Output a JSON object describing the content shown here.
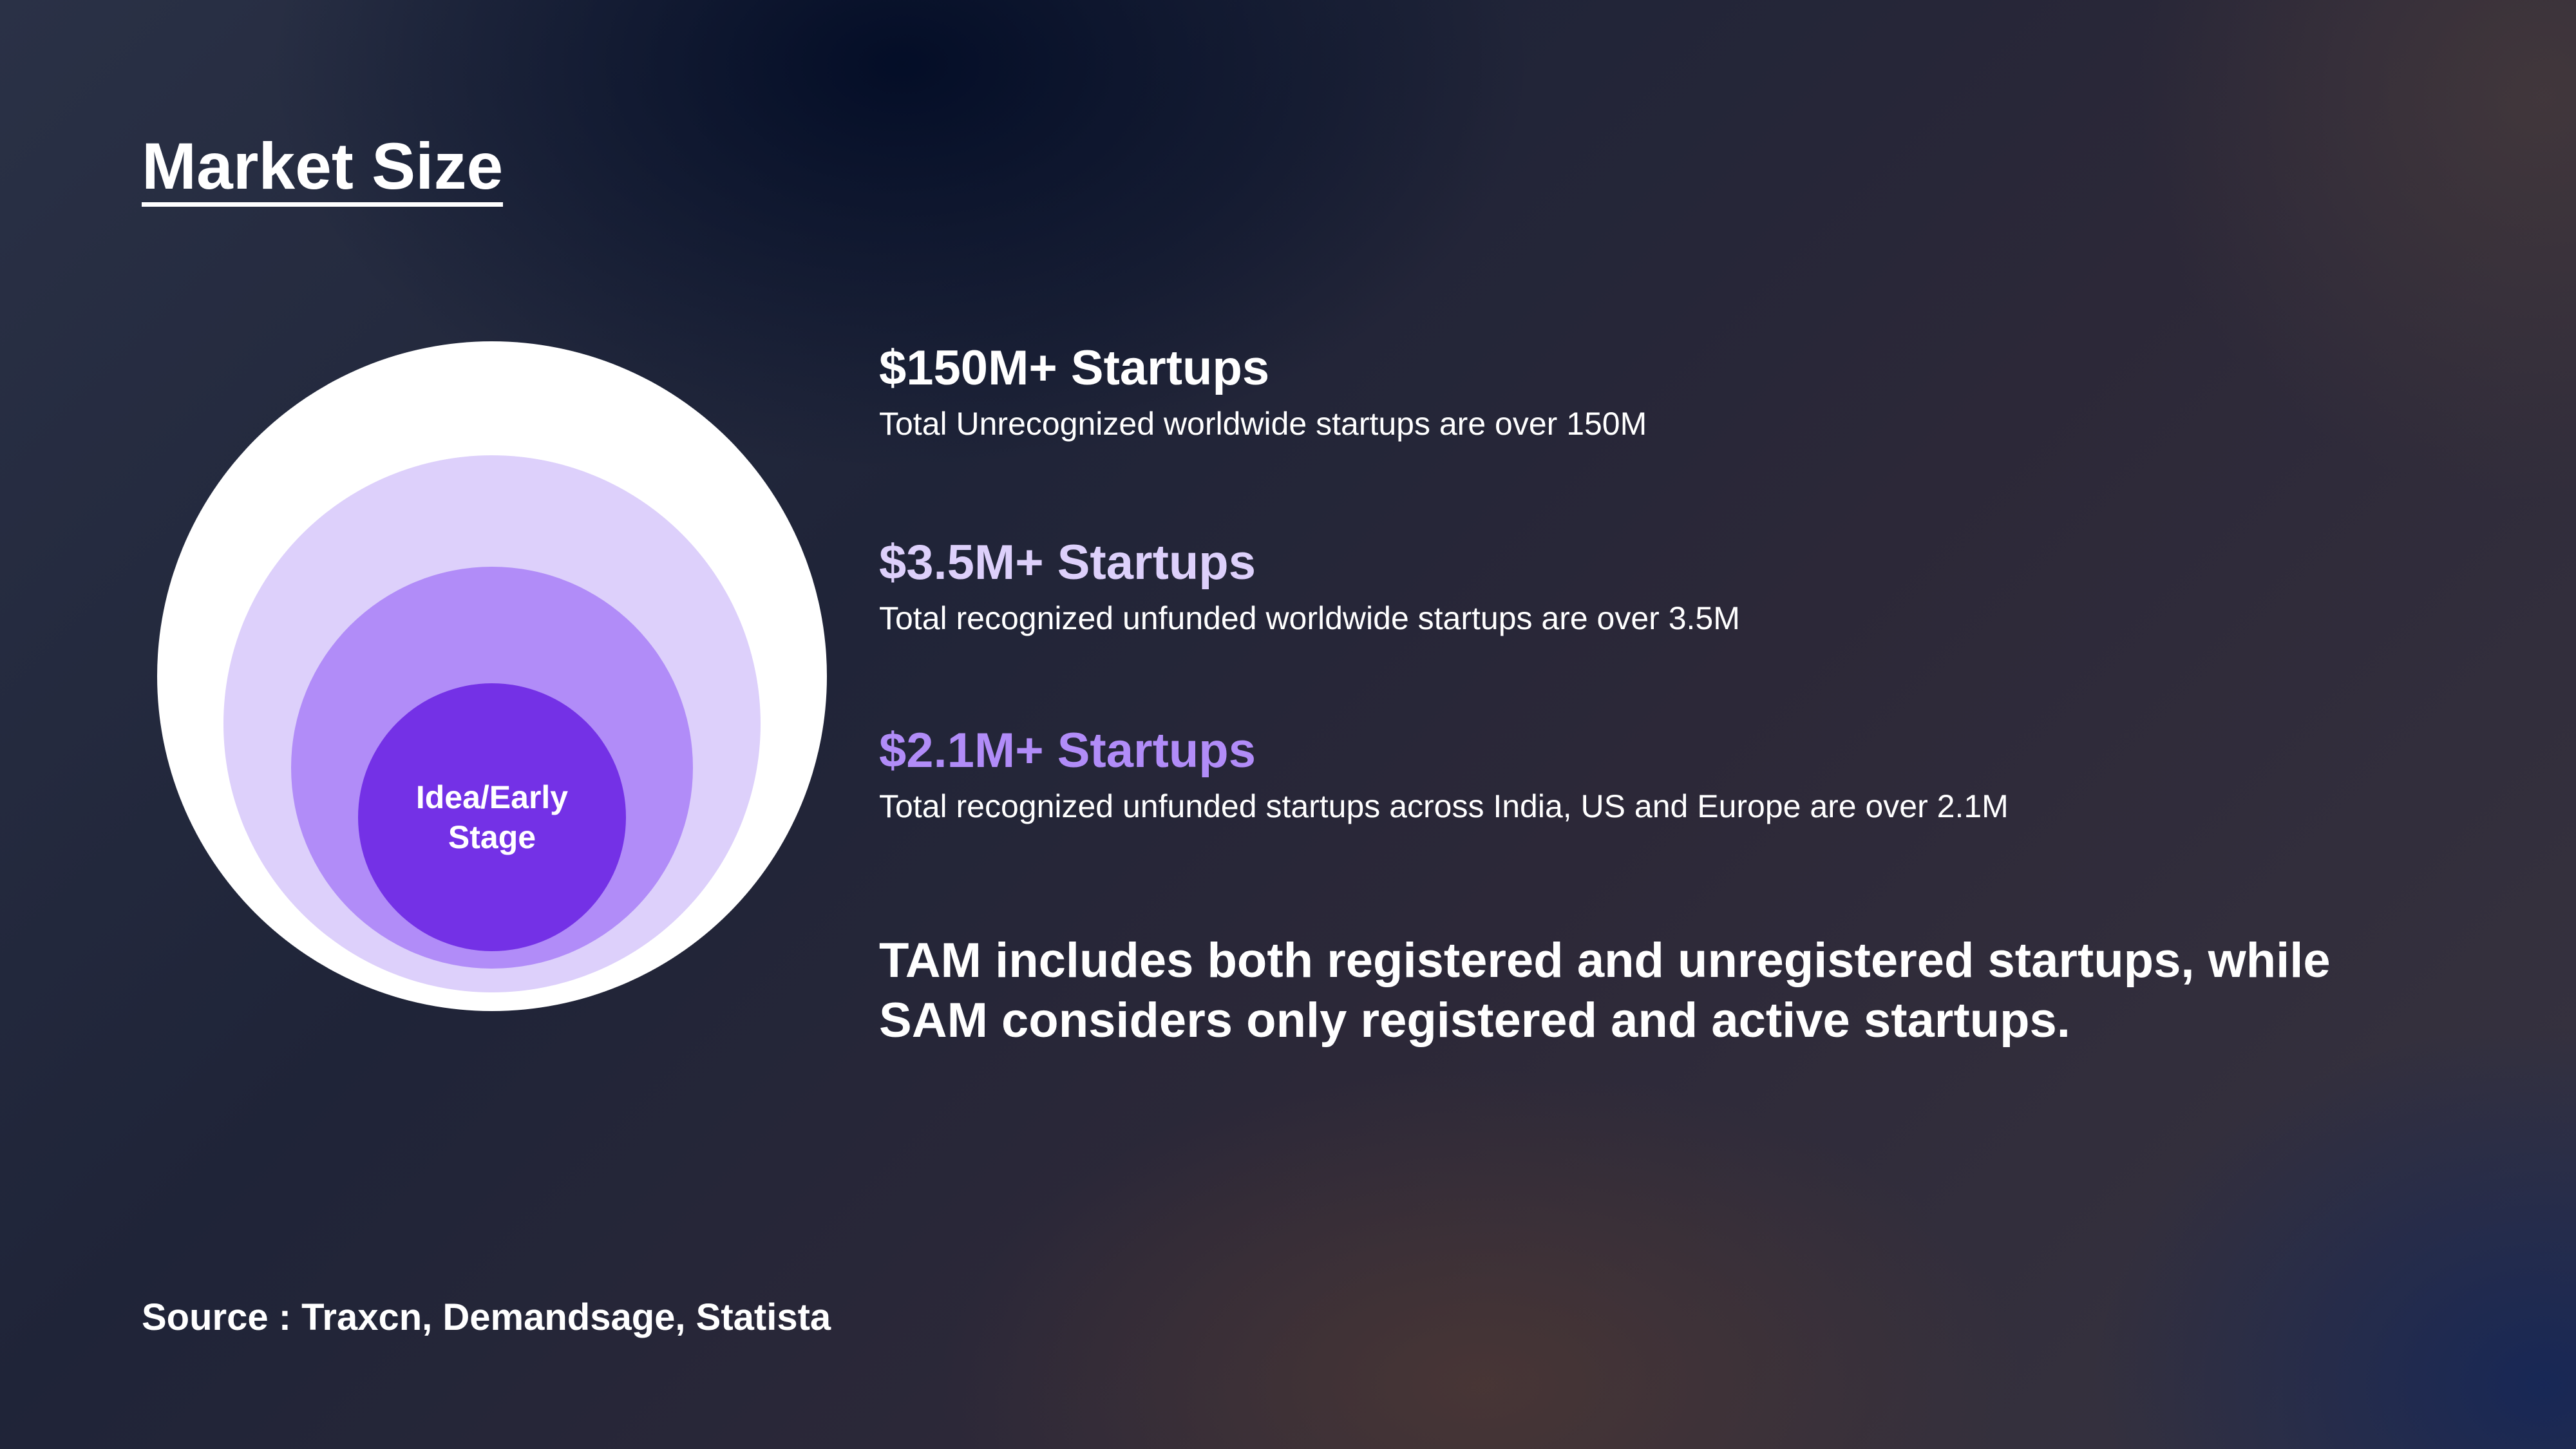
{
  "title": "Market Size",
  "diagram": {
    "inner_label": "Idea/Early\nStage",
    "colors": {
      "outer": "#ffffff",
      "second": "#ddd0fb",
      "third": "#b18cf8",
      "inner": "#7431e6"
    }
  },
  "items": [
    {
      "heading": "$150M+ Startups",
      "description": "Total Unrecognized worldwide startups are over 150M",
      "color": "#ffffff"
    },
    {
      "heading": "$3.5M+ Startups",
      "description": "Total recognized unfunded worldwide startups are over 3.5M",
      "color": "#ddd0fb"
    },
    {
      "heading": "$2.1M+ Startups",
      "description": "Total recognized unfunded startups across India, US and Europe are over 2.1M",
      "color": "#b18cf8"
    }
  ],
  "summary": "TAM includes both registered and unregistered startups, while SAM considers only registered and active startups.",
  "source": "Source : Traxcn, Demandsage, Statista"
}
